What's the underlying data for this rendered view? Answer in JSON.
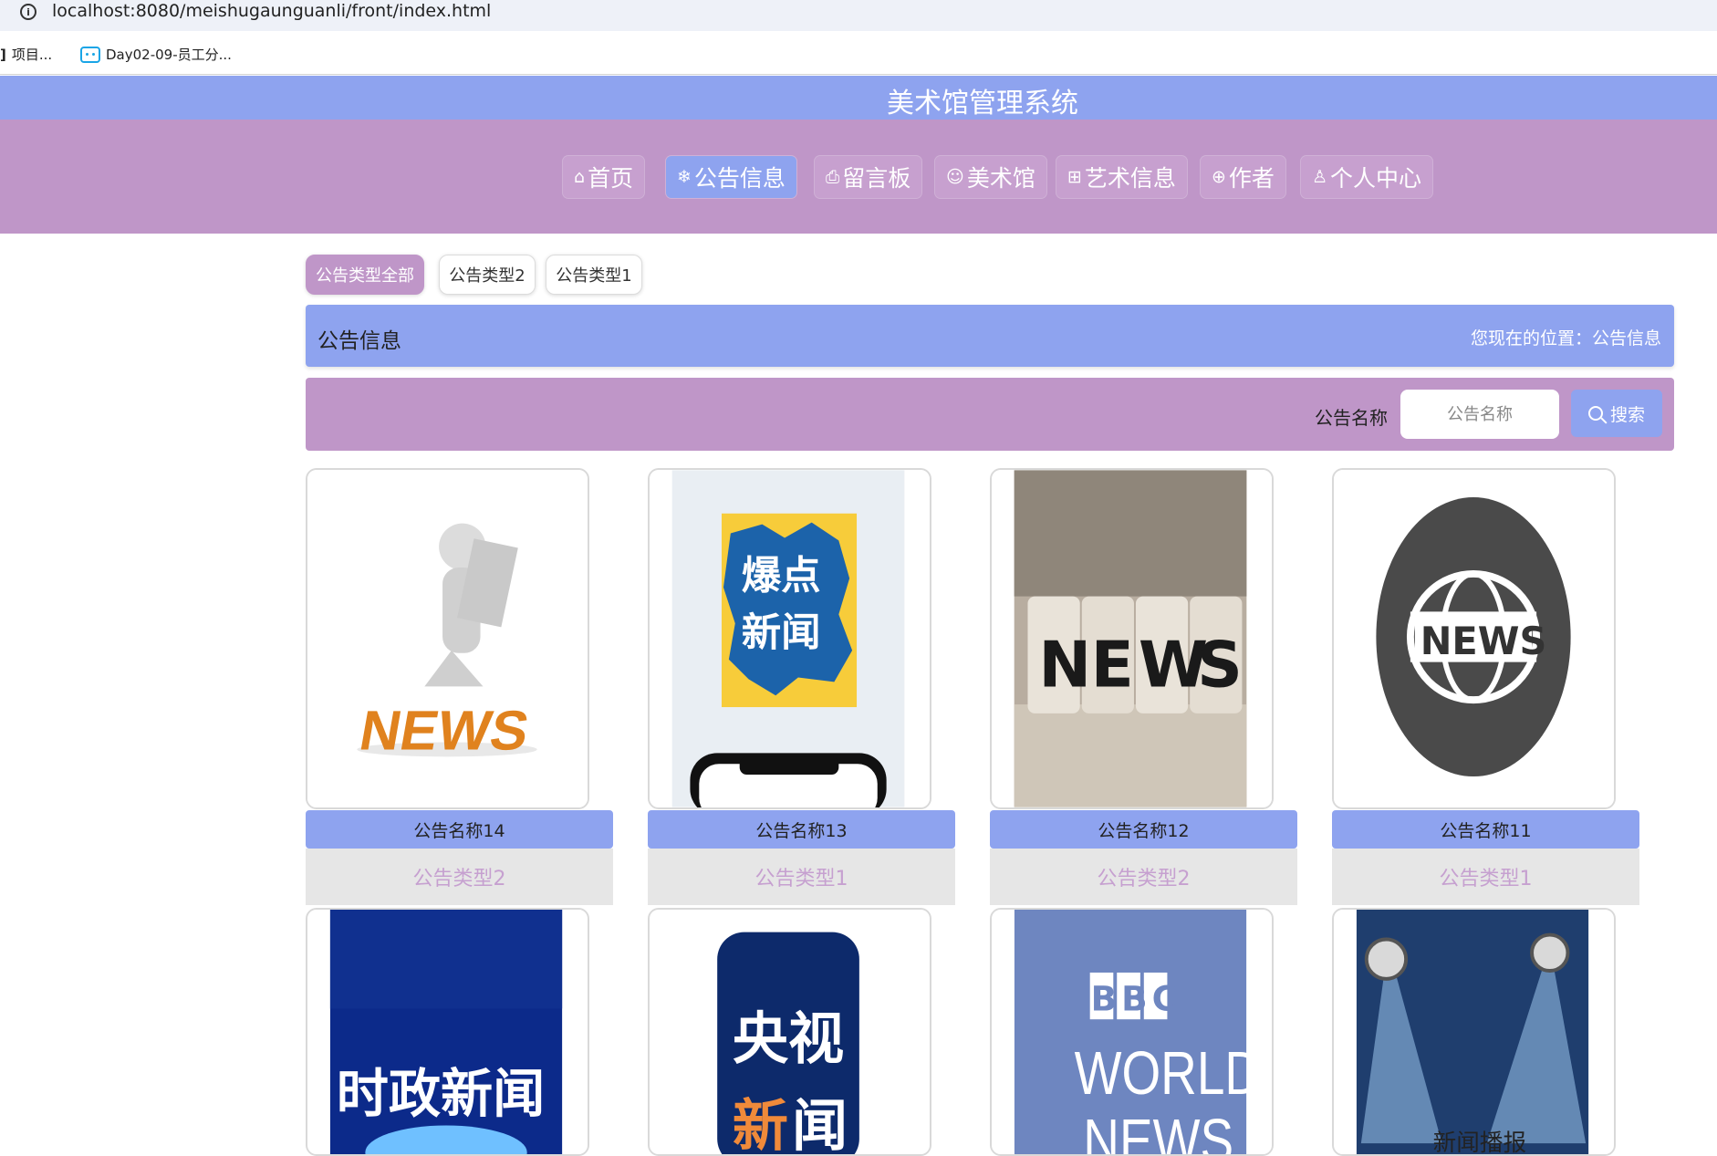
{
  "browser": {
    "url": "localhost:8080/meishugaunguanli/front/index.html",
    "bookmarks": [
      "项目...",
      "Day02-09-员工分..."
    ]
  },
  "site": {
    "title": "美术馆管理系统",
    "nav": [
      {
        "label": "首页",
        "icon": "home-icon",
        "glyph": "⌂"
      },
      {
        "label": "公告信息",
        "icon": "snowflake-icon",
        "glyph": "❄"
      },
      {
        "label": "留言板",
        "icon": "printer-icon",
        "glyph": "⎙"
      },
      {
        "label": "美术馆",
        "icon": "smile-icon",
        "glyph": "☺"
      },
      {
        "label": "艺术信息",
        "icon": "grid-icon",
        "glyph": "⊞"
      },
      {
        "label": "作者",
        "icon": "globe-icon",
        "glyph": "⊕"
      },
      {
        "label": "个人中心",
        "icon": "user-icon",
        "glyph": "♙"
      }
    ],
    "active_nav": "公告信息"
  },
  "categories": [
    "公告类型全部",
    "公告类型2",
    "公告类型1"
  ],
  "breadcrumb": {
    "title": "公告信息",
    "location": "您现在的位置：公告信息"
  },
  "search": {
    "label": "公告名称",
    "placeholder": "公告名称",
    "button": "搜索"
  },
  "cards": [
    {
      "name": "公告名称14",
      "type": "公告类型2",
      "image": "news-man-3d"
    },
    {
      "name": "公告名称13",
      "type": "公告类型1",
      "image": "baodian-xinwen"
    },
    {
      "name": "公告名称12",
      "type": "公告类型2",
      "image": "news-dice"
    },
    {
      "name": "公告名称11",
      "type": "公告类型1",
      "image": "news-globe"
    },
    {
      "name": "",
      "type": "",
      "image": "shizheng-xinwen"
    },
    {
      "name": "",
      "type": "",
      "image": "yangshi-xinwen"
    },
    {
      "name": "",
      "type": "",
      "image": "bbc-world-news"
    },
    {
      "name": "",
      "type": "",
      "image": "xinwen-bobao"
    }
  ],
  "image_text": {
    "img1": "NEWS",
    "img2a": "爆点",
    "img2b": "新闻",
    "img3": [
      "N",
      "E",
      "W",
      "S"
    ],
    "img4": "NEWS",
    "img5": "时政新闻",
    "img6a": "央视",
    "img6b": "新",
    "img6c": "闻",
    "img7a": "BBC",
    "img7b": "WORLD",
    "img7c": "NEWS",
    "img8": "新闻播报"
  },
  "colors": {
    "accent_blue": "#8ea3ef",
    "accent_purple": "#bf96c8",
    "type_text": "#c6a0d0",
    "card_type_bg": "#e6e6e6"
  }
}
